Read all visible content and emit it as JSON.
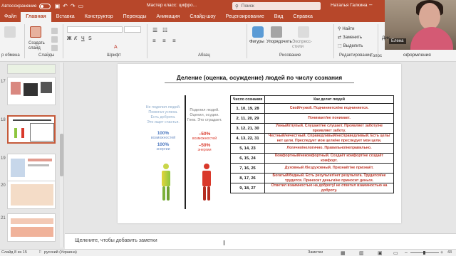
{
  "titlebar": {
    "autosave": "Автосохранение",
    "doc_title": "Мастер класс: цифро...",
    "search_placeholder": "Поиск",
    "user_name": "Наталья Галкина"
  },
  "tabs": [
    "Файл",
    "Главная",
    "Вставка",
    "Конструктор",
    "Переходы",
    "Анимация",
    "Слайд-шоу",
    "Рецензирование",
    "Вид",
    "Справка"
  ],
  "active_tab": "Главная",
  "ribbon": {
    "clipboard_label": "р обмена",
    "slides": {
      "create": "Создать слайд",
      "label": "Слайды"
    },
    "font_label": "Шрифт",
    "paragraph_label": "Абзац",
    "drawing": {
      "shapes": "Фигуры",
      "arrange": "Упорядочить",
      "styles": "Экспресс-стили",
      "label": "Рисование"
    },
    "editing": {
      "find": "Найти",
      "replace": "Заменить",
      "select": "Выделить",
      "label": "Редактирование"
    },
    "voice_label": "Голос",
    "dictate": "Дик",
    "design_label": "оформления"
  },
  "webcam": {
    "name": "Елена"
  },
  "thumbnails": {
    "numbers": [
      "17",
      "18",
      "19",
      "20",
      "21",
      "22",
      "23"
    ]
  },
  "slide": {
    "title": "Деление (оценка, осуждение) людей по числу сознания",
    "col_a": {
      "lines": [
        "Не поделил людей.",
        "Помогал успеха.",
        "Есть доброта.",
        "Это ищет счастья."
      ],
      "pct": "100%",
      "pct_label": "возможностей",
      "pct2": "100%",
      "pct2_label": "энергии"
    },
    "col_b": {
      "lines": [
        "Поделил людей.",
        "Оценил, осудил.",
        "Гнев. Это страдает."
      ],
      "pct": "–50%",
      "pct_label": "возможностей",
      "pct2": "–50%",
      "pct2_label": "энергии"
    },
    "table": {
      "headers": [
        "Число сознания",
        "Как делит людей"
      ],
      "rows": [
        {
          "num": "1, 10, 19, 28",
          "desc": "Свой/чужой. Подчиняется/не подчиняется."
        },
        {
          "num": "2, 11, 20, 29",
          "desc": "Понимает/не понимает."
        },
        {
          "num": "3, 12, 21, 30",
          "desc": "Умный/глупый. Слушает/не слушает. Проявляет заботу/не проявляет заботу."
        },
        {
          "num": "4, 13, 22, 31",
          "desc": "Честный/нечестный. Справедливый/несправедливый. Есть цель/нет цели. Преследует мои цели/не преследует мои цели."
        },
        {
          "num": "5, 14, 23",
          "desc": "Логично/нелогично. Правильно/неправильно."
        },
        {
          "num": "6, 15, 24",
          "desc": "Комфортный/некомфортный. Создаёт комфорт/не создаёт комфорт."
        },
        {
          "num": "7, 16, 25",
          "desc": "Духовный /бездуховный. Признаёт/не признаёт."
        },
        {
          "num": "8, 17, 26",
          "desc": "Богатый/бедный. Есть результат/нет результата. Трудится/не трудится. Приносит деньги/не приносит деньги."
        },
        {
          "num": "9, 18, 27",
          "desc": "Ответил взаимностью на доброту/ не ответил взаимностью на доброту."
        }
      ]
    }
  },
  "notes": {
    "placeholder": "Щелкните, чтобы добавить заметки"
  },
  "status": {
    "slide_info": "Слайд 8 из 15",
    "language": "русский (Украина)",
    "notes_btn": "Заметки",
    "zoom": "43"
  },
  "colors": {
    "accent": "#b7472a",
    "table_text": "#c0392b",
    "green_fig": "#8dc63f",
    "red_fig": "#d9382a"
  }
}
